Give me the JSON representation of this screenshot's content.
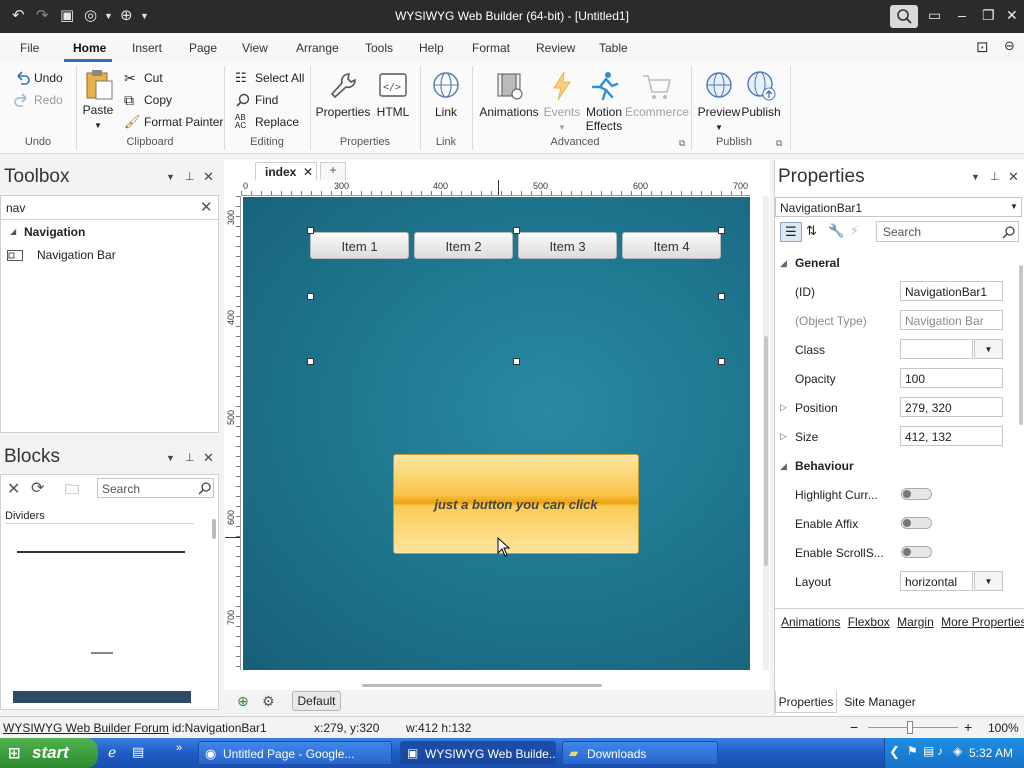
{
  "app": {
    "title": "WYSIWYG Web Builder (64-bit) - [Untitled1]"
  },
  "menu": [
    "File",
    "Home",
    "Insert",
    "Page",
    "View",
    "Arrange",
    "Tools",
    "Help",
    "Format",
    "Review",
    "Table"
  ],
  "ribbon": {
    "undo": "Undo",
    "redo": "Redo",
    "group_undo": "Undo",
    "paste": "Paste",
    "cut": "Cut",
    "copy": "Copy",
    "format_painter": "Format Painter",
    "group_clipboard": "Clipboard",
    "select_all": "Select All",
    "find": "Find",
    "replace": "Replace",
    "group_editing": "Editing",
    "properties": "Properties",
    "html": "HTML",
    "group_properties": "Properties",
    "link": "Link",
    "group_link": "Link",
    "animations": "Animations",
    "events": "Events",
    "motion_effects_1": "Motion",
    "motion_effects_2": "Effects",
    "ecommerce": "Ecommerce",
    "group_advanced": "Advanced",
    "preview": "Preview",
    "publish": "Publish",
    "group_publish": "Publish"
  },
  "toolbox": {
    "title": "Toolbox",
    "search_value": "nav",
    "category": "Navigation",
    "item": "Navigation Bar"
  },
  "blocks": {
    "title": "Blocks",
    "search_placeholder": "Search",
    "category": "Dividers"
  },
  "document": {
    "tab": "index",
    "tab_add": "+",
    "ruler_top": [
      "0",
      "300",
      "400",
      "500",
      "600",
      "700"
    ],
    "ruler_left": [
      "300",
      "400",
      "500",
      "600",
      "700"
    ],
    "nav_items": [
      "Item 1",
      "Item 2",
      "Item 3",
      "Item 4"
    ],
    "button_text": "just a button you can click",
    "layer_button": "Default"
  },
  "properties": {
    "title": "Properties",
    "object": "NavigationBar1",
    "search_placeholder": "Search",
    "cat_general": "General",
    "id_label": "(ID)",
    "id_value": "NavigationBar1",
    "type_label": "(Object Type)",
    "type_value": "Navigation Bar",
    "class_label": "Class",
    "class_value": "",
    "opacity_label": "Opacity",
    "opacity_value": "100",
    "position_label": "Position",
    "position_value": "279, 320",
    "size_label": "Size",
    "size_value": "412, 132",
    "cat_behaviour": "Behaviour",
    "highlight_label": "Highlight Curr...",
    "affix_label": "Enable Affix",
    "scrollspy_label": "Enable ScrollS...",
    "layout_label": "Layout",
    "layout_value": "horizontal",
    "links": [
      "Animations",
      "Flexbox",
      "Margin",
      "More Properties"
    ],
    "tab_properties": "Properties",
    "tab_site_manager": "Site Manager"
  },
  "status": {
    "forum": "WYSIWYG Web Builder Forum",
    "id": "id:NavigationBar1",
    "xy": "x:279, y:320",
    "wh": "w:412 h:132",
    "zoom": "100%"
  },
  "taskbar": {
    "start": "start",
    "tasks": [
      "Untitled Page - Google...",
      "WYSIWYG Web Builde...",
      "Downloads"
    ],
    "time": "5:32 AM"
  }
}
